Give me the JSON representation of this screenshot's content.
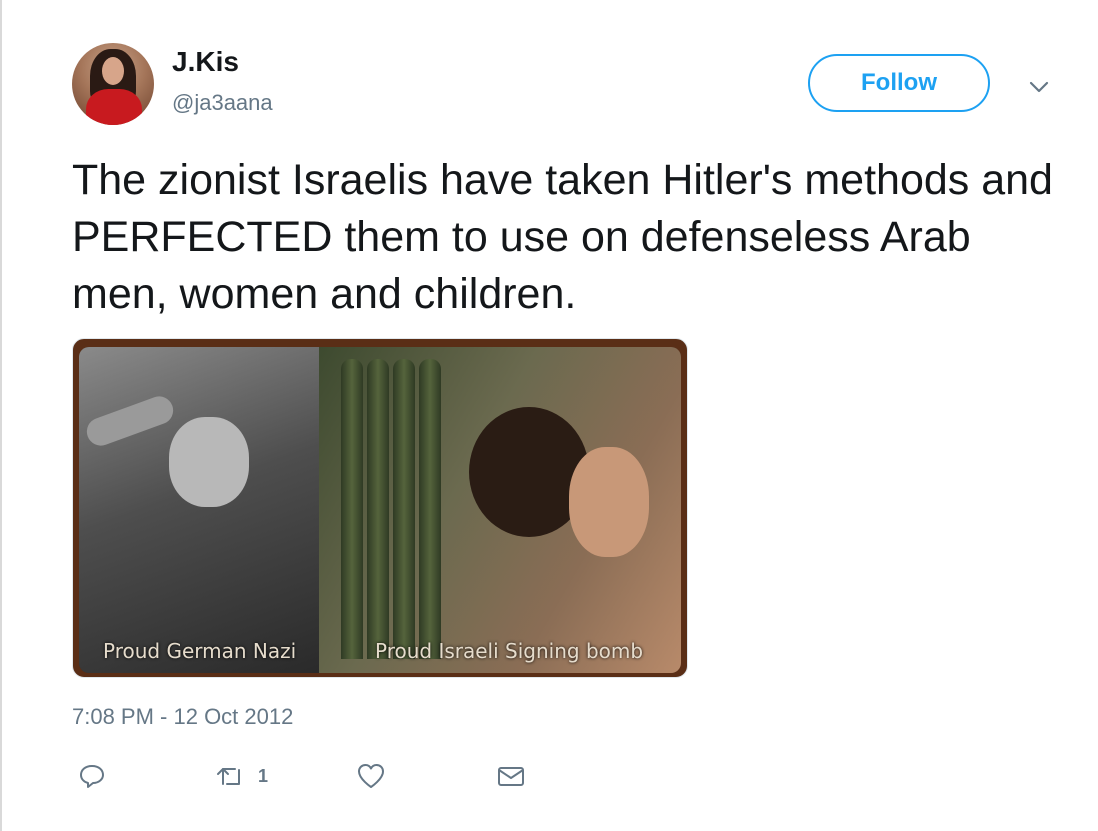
{
  "author": {
    "display_name": "J.Kis",
    "handle": "@ja3aana"
  },
  "header": {
    "follow_label": "Follow"
  },
  "tweet": {
    "text": "The zionist Israelis have taken Hitler's methods and PERFECTED them to use on defenseless Arab men, women and children.",
    "timestamp": "7:08 PM - 12 Oct 2012"
  },
  "media": {
    "caption_left": "Proud German Nazi",
    "caption_right": "Proud Israeli Signing bomb"
  },
  "actions": {
    "reply_icon": "reply-icon",
    "retweet_icon": "retweet-icon",
    "retweet_count": "1",
    "like_icon": "heart-icon",
    "dm_icon": "envelope-icon"
  },
  "colors": {
    "accent": "#1da1f2",
    "text": "#14171a",
    "muted": "#657786"
  }
}
